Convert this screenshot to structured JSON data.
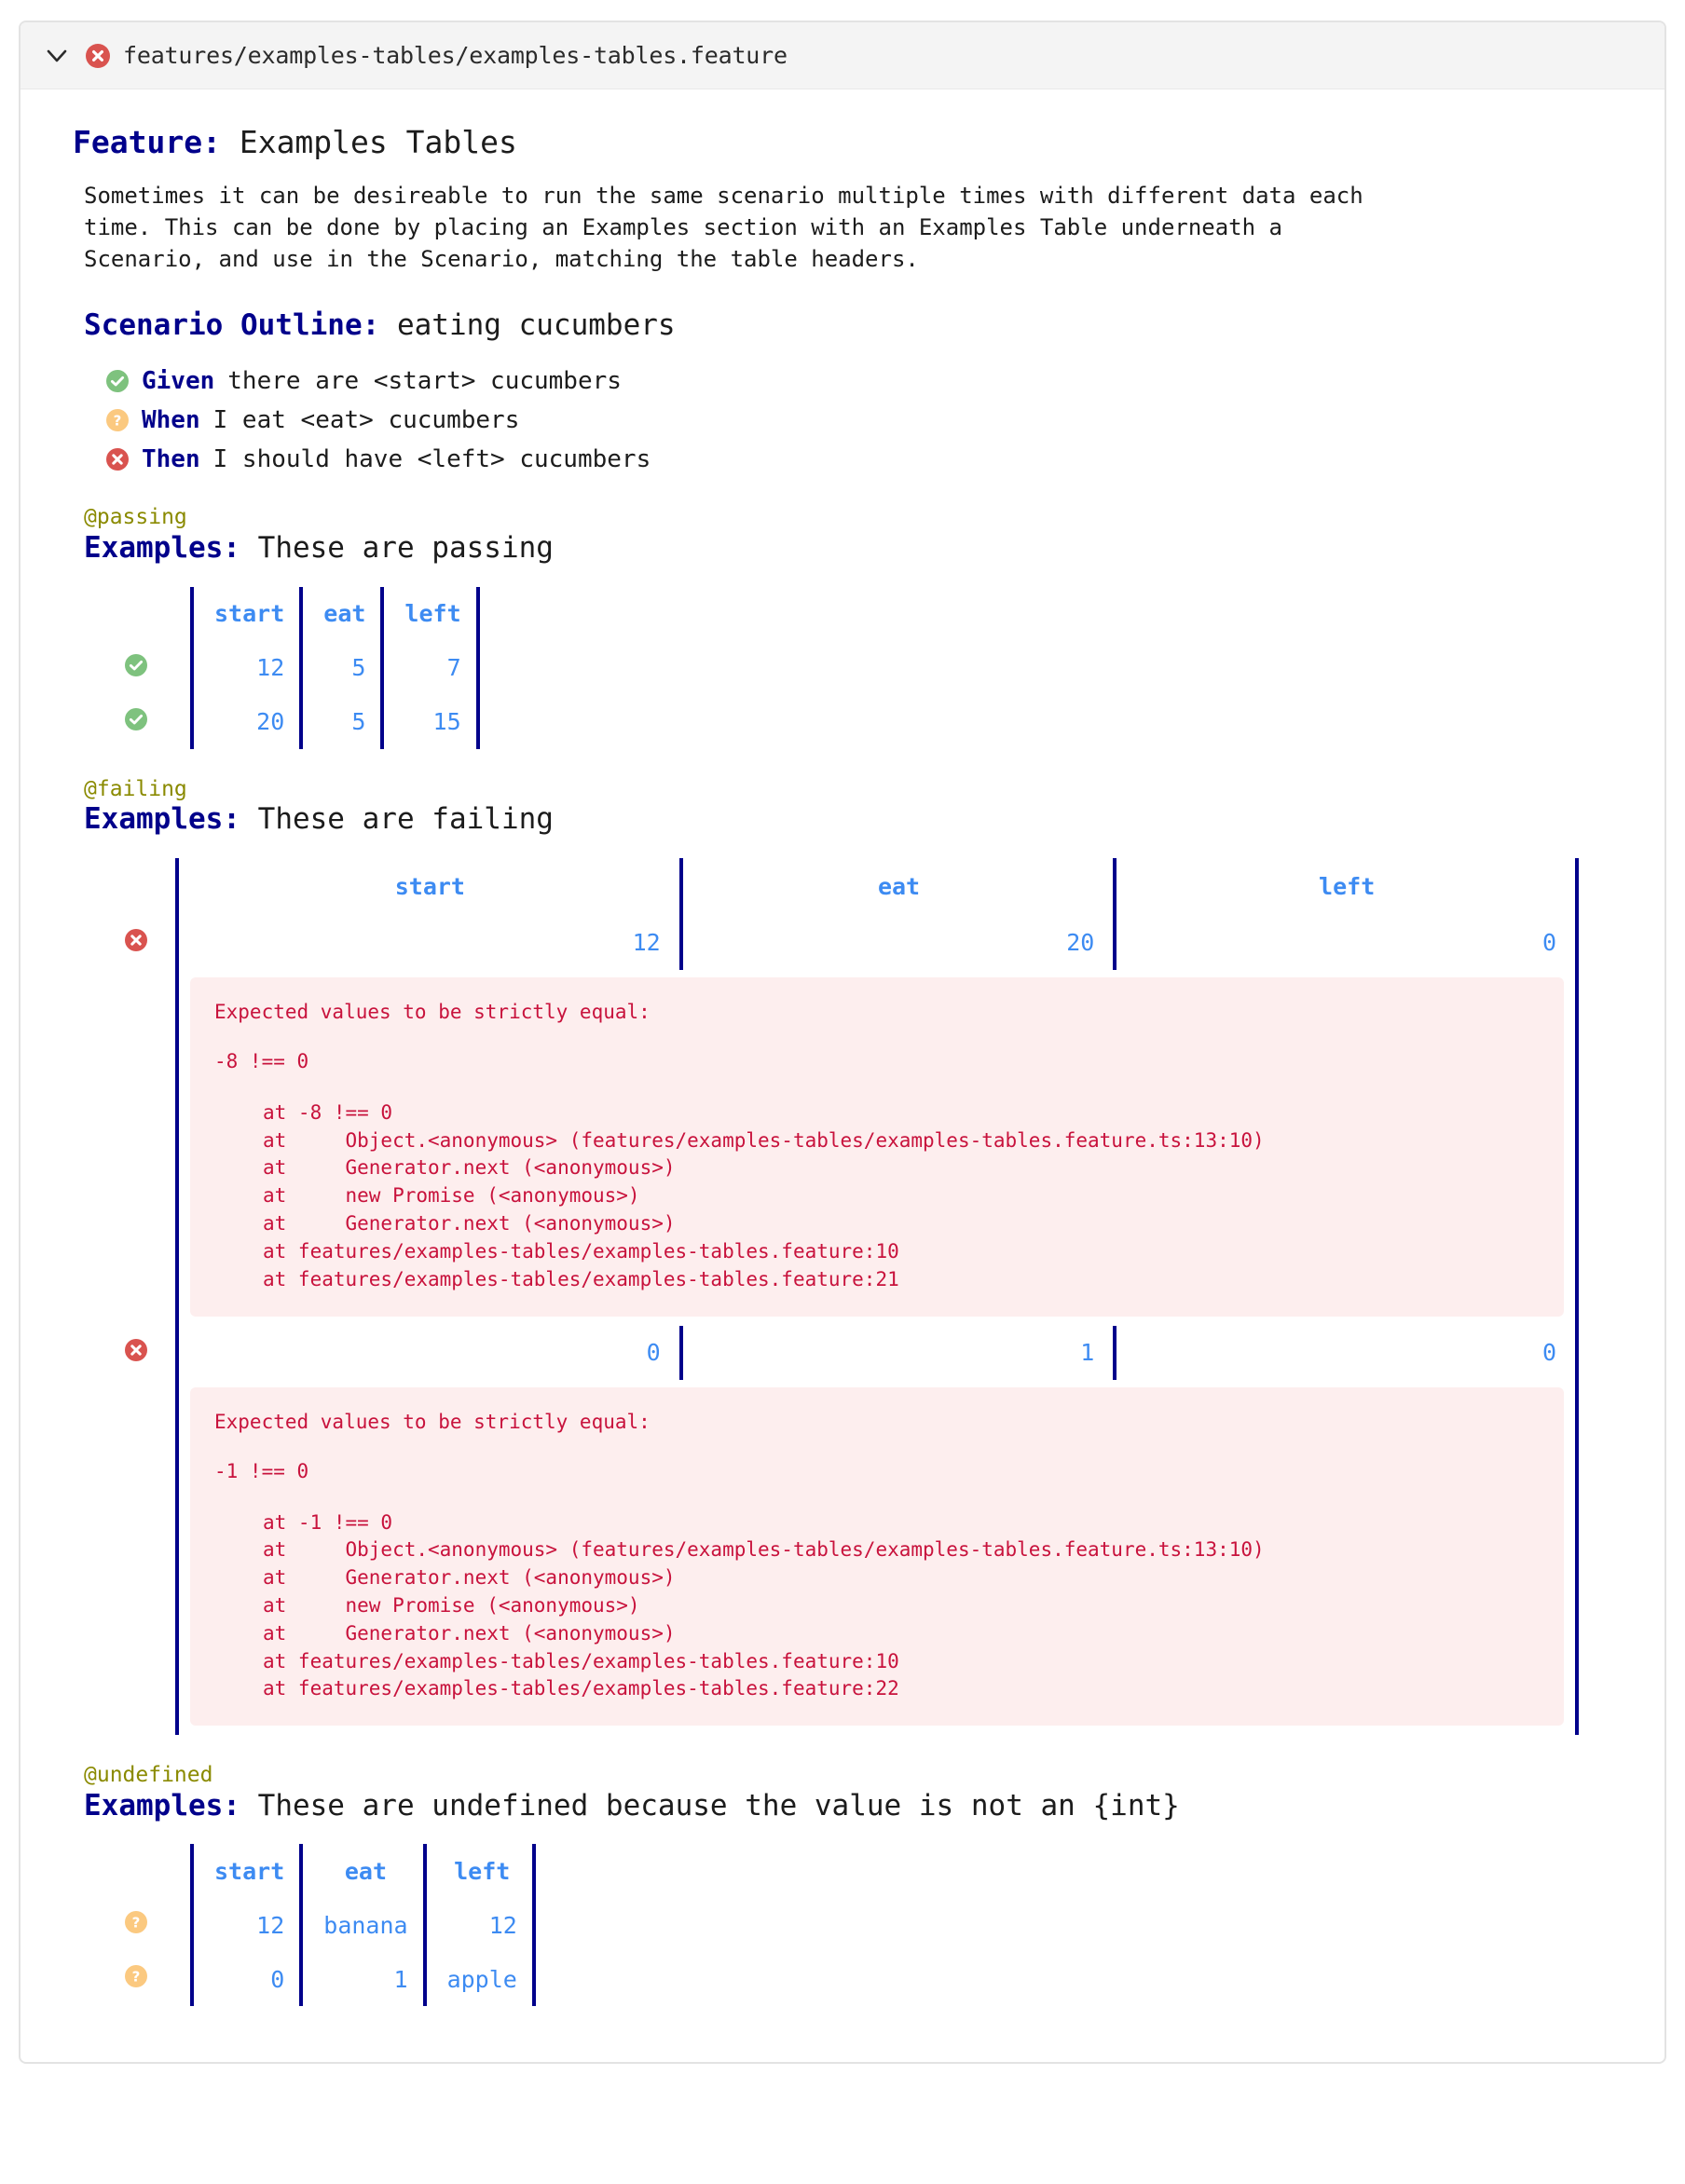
{
  "header": {
    "collapse_icon": "chevron-down-icon",
    "status_icon": "failed-icon",
    "file_path": "features/examples-tables/examples-tables.feature"
  },
  "feature": {
    "keyword": "Feature:",
    "name": "Examples Tables",
    "description": "Sometimes it can be desireable to run the same scenario multiple times with different data each\ntime. This can be done by placing an Examples section with an Examples Table underneath a\nScenario, and use in the Scenario, matching the table headers."
  },
  "scenario": {
    "keyword": "Scenario Outline:",
    "name": "eating cucumbers",
    "steps": [
      {
        "status": "passed",
        "keyword": "Given",
        "text": "there are <start> cucumbers"
      },
      {
        "status": "undefined",
        "keyword": "When",
        "text": "I eat <eat> cucumbers"
      },
      {
        "status": "failed",
        "keyword": "Then",
        "text": "I should have <left> cucumbers"
      }
    ]
  },
  "examples": [
    {
      "tag": "@passing",
      "keyword": "Examples:",
      "name": "These are passing",
      "headers": [
        "start",
        "eat",
        "left"
      ],
      "rows": [
        {
          "status": "passed",
          "values": [
            "12",
            "5",
            "7"
          ]
        },
        {
          "status": "passed",
          "values": [
            "20",
            "5",
            "15"
          ]
        }
      ]
    },
    {
      "tag": "@failing",
      "keyword": "Examples:",
      "name": "These are failing",
      "headers": [
        "start",
        "eat",
        "left"
      ],
      "rows": [
        {
          "status": "failed",
          "values": [
            "12",
            "20",
            "0"
          ],
          "error": {
            "title": "Expected values to be strictly equal:",
            "diff": "-8 !== 0",
            "trace": "at -8 !== 0\nat     Object.<anonymous> (features/examples-tables/examples-tables.feature.ts:13:10)\nat     Generator.next (<anonymous>)\nat     new Promise (<anonymous>)\nat     Generator.next (<anonymous>)\nat features/examples-tables/examples-tables.feature:10\nat features/examples-tables/examples-tables.feature:21"
          }
        },
        {
          "status": "failed",
          "values": [
            "0",
            "1",
            "0"
          ],
          "error": {
            "title": "Expected values to be strictly equal:",
            "diff": "-1 !== 0",
            "trace": "at -1 !== 0\nat     Object.<anonymous> (features/examples-tables/examples-tables.feature.ts:13:10)\nat     Generator.next (<anonymous>)\nat     new Promise (<anonymous>)\nat     Generator.next (<anonymous>)\nat features/examples-tables/examples-tables.feature:10\nat features/examples-tables/examples-tables.feature:22"
          }
        }
      ]
    },
    {
      "tag": "@undefined",
      "keyword": "Examples:",
      "name": "These are undefined because the value is not an {int}",
      "headers": [
        "start",
        "eat",
        "left"
      ],
      "rows": [
        {
          "status": "undefined",
          "values": [
            "12",
            "banana",
            "12"
          ]
        },
        {
          "status": "undefined",
          "values": [
            "0",
            "1",
            "apple"
          ]
        }
      ]
    }
  ],
  "colors": {
    "keyword": "#00008b",
    "table_text": "#3d8bf2",
    "table_border": "#00008b",
    "tag": "#8a8a00",
    "error_text": "#c8123c",
    "error_bg": "#fdeeee",
    "passed": "#7ec27e",
    "failed": "#d9534f",
    "undefined": "#fbc980",
    "header_bg": "#f4f4f4"
  }
}
